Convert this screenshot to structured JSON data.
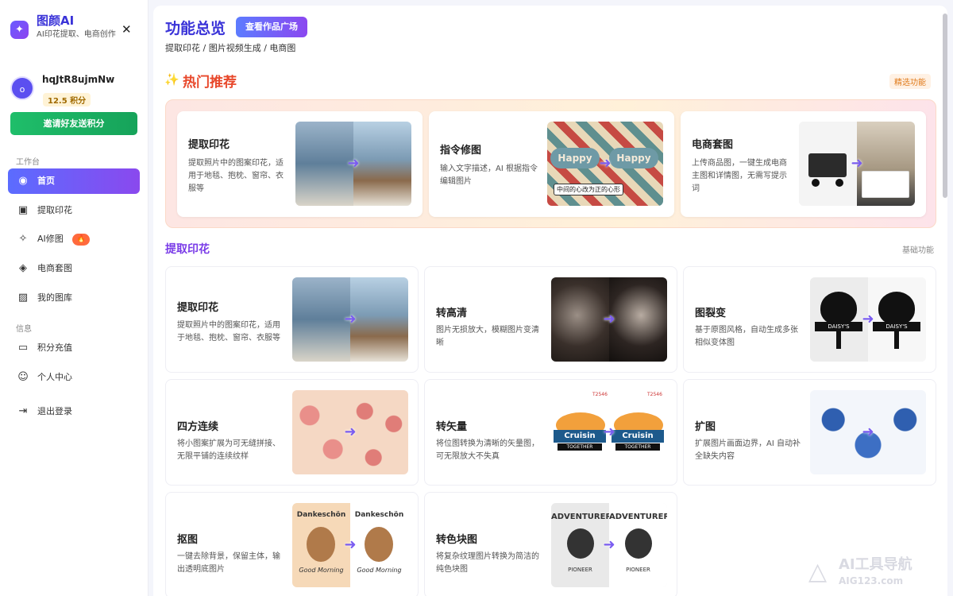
{
  "brand": {
    "name": "图颜AI",
    "tagline": "AI印花提取、电商创作"
  },
  "user": {
    "avatar_initial": "o",
    "name": "hqJtR8ujmNw",
    "credits": "12.5 积分"
  },
  "invite_label": "邀请好友送积分",
  "sidebar": {
    "workspace_label": "工作台",
    "info_label": "信息",
    "items": [
      {
        "label": "首页"
      },
      {
        "label": "提取印花"
      },
      {
        "label": "AI修图"
      },
      {
        "label": "电商套图"
      },
      {
        "label": "我的图库"
      },
      {
        "label": "积分充值"
      },
      {
        "label": "个人中心"
      },
      {
        "label": "退出登录"
      }
    ]
  },
  "header": {
    "title": "功能总览",
    "gallery_button": "查看作品广场",
    "breadcrumb": "提取印花 / 图片视频生成 / 电商图"
  },
  "hot": {
    "title": "热门推荐",
    "badge": "精选功能",
    "cards": [
      {
        "title": "提取印花",
        "desc": "提取照片中的图案印花，适用于地毯、抱枕、窗帘、衣服等"
      },
      {
        "title": "指令修图",
        "desc": "输入文字描述，AI 根据指令编辑图片",
        "img_text_left": "Happy",
        "img_text_right": "Happy",
        "img_caption": "中间的心改为正的心形"
      },
      {
        "title": "电商套图",
        "desc": "上传商品图，一键生成电商主图和详情图，无需写提示词"
      }
    ]
  },
  "section": {
    "title": "提取印花",
    "badge": "基础功能",
    "cards": [
      {
        "title": "提取印花",
        "desc": "提取照片中的图案印花，适用于地毯、抱枕、窗帘、衣服等"
      },
      {
        "title": "转高清",
        "desc": "图片无损放大，模糊图片变清晰"
      },
      {
        "title": "图裂变",
        "desc": "基于原图风格，自动生成多张相似变体图",
        "img_text": "DAISY'S"
      },
      {
        "title": "四方连续",
        "desc": "将小图案扩展为可无缝拼接、无限平铺的连续纹样"
      },
      {
        "title": "转矢量",
        "desc": "将位图转换为清晰的矢量图，可无限放大不失真",
        "img_text": "Cruisin",
        "img_sub": "TOGETHER",
        "img_code": "T2546"
      },
      {
        "title": "扩图",
        "desc": "扩展图片画面边界，AI 自动补全缺失内容"
      },
      {
        "title": "抠图",
        "desc": "一键去除背景，保留主体，输出透明底图片",
        "img_text": "Dankeschön",
        "img_sub": "Good Morning"
      },
      {
        "title": "转色块图",
        "desc": "将复杂纹理图片转换为简洁的纯色块图",
        "img_text": "ADVENTURER",
        "img_sub": "PIONEER"
      }
    ]
  },
  "watermark": {
    "title": "AI工具导航",
    "url": "AIG123.com"
  }
}
